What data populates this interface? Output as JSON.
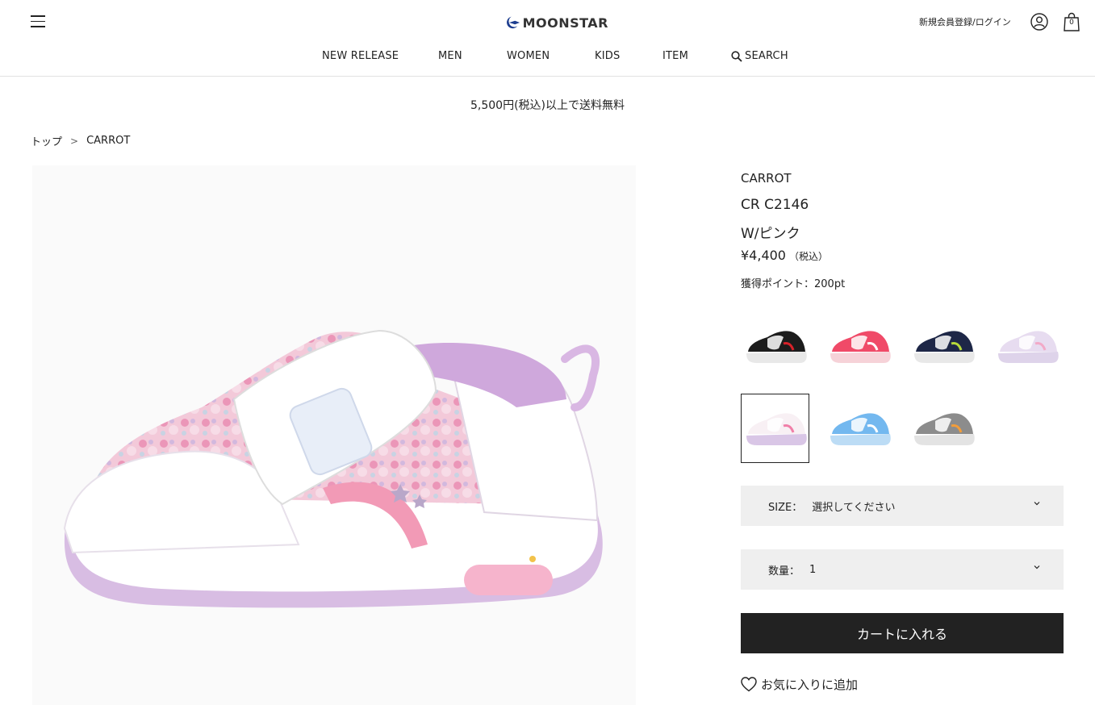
{
  "header": {
    "logo_text": "moonstar",
    "login_label": "新規会員登録/ログイン",
    "cart_count": "0"
  },
  "nav": {
    "items": [
      "NEW RELEASE",
      "MEN",
      "WOMEN",
      "KIDS",
      "ITEM"
    ],
    "search_label": "SEARCH"
  },
  "shipping_notice": "5,500円(税込)以上で送料無料",
  "breadcrumb": {
    "home": "トップ",
    "separator": ">",
    "current": "CARROT"
  },
  "product": {
    "brand": "CARROT",
    "model": "CR C2146",
    "color": "W/ピンク",
    "price": "¥4,400",
    "tax_note": "（税込）",
    "points": "獲得ポイント：200pt",
    "image_icon": "pink-white-kids-sneaker-image"
  },
  "swatches": [
    {
      "name": "black",
      "body": "#1c1c1c",
      "accent": "#d8222a",
      "sole": "#e8e8e8",
      "selected": false
    },
    {
      "name": "red-pink",
      "body": "#f04a68",
      "accent": "#ffffff",
      "sole": "#f6d2d8",
      "selected": false
    },
    {
      "name": "navy",
      "body": "#1e2747",
      "accent": "#b7d93a",
      "sole": "#e8e8e8",
      "selected": false
    },
    {
      "name": "lavender",
      "body": "#e7dcf0",
      "accent": "#f2a9c7",
      "sole": "#ded3ea",
      "selected": false
    },
    {
      "name": "white-pink",
      "body": "#f8f0f4",
      "accent": "#f07fa8",
      "sole": "#d9c6e6",
      "selected": true
    },
    {
      "name": "sax-blue",
      "body": "#73b8ef",
      "accent": "#ffffff",
      "sole": "#bcdcf5",
      "selected": false
    },
    {
      "name": "gray",
      "body": "#8c8c8c",
      "accent": "#f29d3a",
      "sole": "#e3e3e3",
      "selected": false
    }
  ],
  "size_select": {
    "label": "SIZE：",
    "value": "選択してください"
  },
  "quantity_select": {
    "label": "数量：",
    "value": "1"
  },
  "cart_button_label": "カートに入れる",
  "favorite_label": "お気に入りに追加",
  "colors": {
    "button_bg": "#222222",
    "select_bg": "#efefef",
    "logo_blue": "#1d3d8f"
  }
}
